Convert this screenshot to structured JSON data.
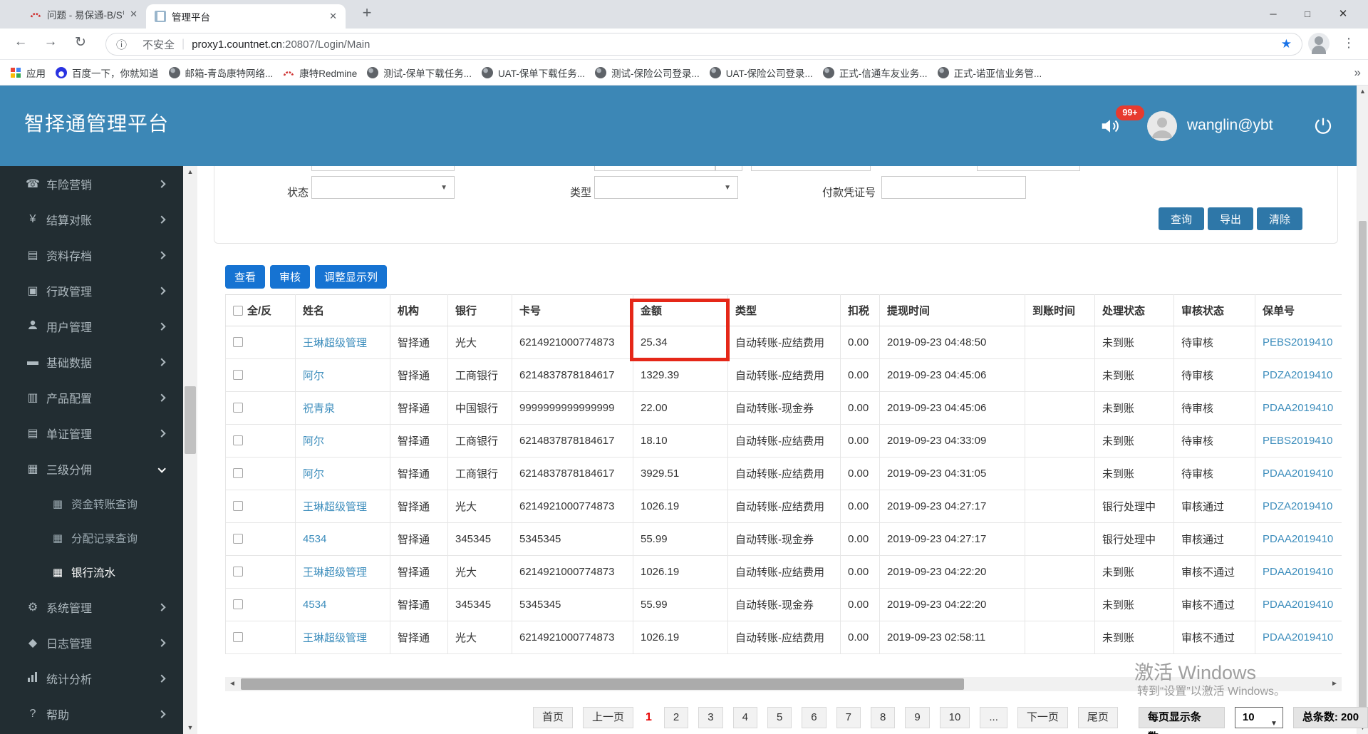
{
  "browser": {
    "tabs": [
      {
        "title": "问题 - 易保通-B/S管理系统 - Re...",
        "icon": "redmine-icon",
        "active": false
      },
      {
        "title": "管理平台",
        "icon": "tab-document-icon",
        "active": true
      }
    ],
    "tab_close": "✕",
    "new_tab_button": "+",
    "window_controls": {
      "minimize": "─",
      "maximize": "□",
      "close": "✕"
    },
    "nav": {
      "back": "←",
      "forward": "→",
      "reload": "↻"
    },
    "omnibox": {
      "info_icon": "ⓘ",
      "security_label": "不安全",
      "separator": "|",
      "host": "proxy1.countnet.cn",
      "path": ":20807/Login/Main"
    },
    "star_icon": "★",
    "menu_icon": "⋮",
    "bookmarks": [
      {
        "label": "应用",
        "icon": "apps-grid-icon"
      },
      {
        "label": "百度一下，你就知道",
        "icon": "baidu-icon"
      },
      {
        "label": "邮箱-青岛康特网络...",
        "icon": "globe-icon"
      },
      {
        "label": "康特Redmine",
        "icon": "redmine-icon"
      },
      {
        "label": "测试-保单下载任务...",
        "icon": "globe-icon"
      },
      {
        "label": "UAT-保单下载任务...",
        "icon": "globe-icon"
      },
      {
        "label": "测试-保险公司登录...",
        "icon": "globe-icon"
      },
      {
        "label": "UAT-保险公司登录...",
        "icon": "globe-icon"
      },
      {
        "label": "正式-信通车友业务...",
        "icon": "globe-icon"
      },
      {
        "label": "正式-诺亚信业务管...",
        "icon": "globe-icon"
      }
    ],
    "bookmarks_overflow": "»"
  },
  "header": {
    "title": "智择通管理平台",
    "notification_badge": "99+",
    "username": "wanglin@ybt"
  },
  "sidebar": {
    "items": [
      {
        "label": "车险营销",
        "icon": "phone-icon",
        "chevron": "right"
      },
      {
        "label": "结算对账",
        "icon": "yen-icon",
        "chevron": "right"
      },
      {
        "label": "资料存档",
        "icon": "archive-icon",
        "chevron": "right"
      },
      {
        "label": "行政管理",
        "icon": "briefcase-icon",
        "chevron": "right"
      },
      {
        "label": "用户管理",
        "icon": "user-icon",
        "chevron": "right"
      },
      {
        "label": "基础数据",
        "icon": "database-icon",
        "chevron": "right"
      },
      {
        "label": "产品配置",
        "icon": "book-icon",
        "chevron": "right"
      },
      {
        "label": "单证管理",
        "icon": "document-icon",
        "chevron": "right"
      },
      {
        "label": "三级分佣",
        "icon": "grid-icon",
        "chevron": "down",
        "expanded": true,
        "children": [
          {
            "label": "资金转账查询",
            "icon": "grid-icon",
            "active": false
          },
          {
            "label": "分配记录查询",
            "icon": "grid-icon",
            "active": false
          },
          {
            "label": "银行流水",
            "icon": "grid-icon",
            "active": true
          }
        ]
      },
      {
        "label": "系统管理",
        "icon": "gear-icon",
        "chevron": "right"
      },
      {
        "label": "日志管理",
        "icon": "tag-icon",
        "chevron": "right"
      },
      {
        "label": "统计分析",
        "icon": "chart-icon",
        "chevron": "right"
      },
      {
        "label": "帮助",
        "icon": "help-icon",
        "chevron": "right"
      }
    ]
  },
  "filters": {
    "status_label": "状态",
    "type_label": "类型",
    "voucher_label": "付款凭证号",
    "status_value": "",
    "type_value": "",
    "voucher_value": "",
    "buttons": [
      "查询",
      "导出",
      "清除"
    ]
  },
  "toolbar": {
    "buttons": [
      "查看",
      "审核",
      "调整显示列"
    ]
  },
  "table": {
    "headers": [
      "全/反",
      "姓名",
      "机构",
      "银行",
      "卡号",
      "金额",
      "类型",
      "扣税",
      "提现时间",
      "到账时间",
      "处理状态",
      "审核状态",
      "保单号"
    ],
    "highlighted_column": "金额",
    "rows": [
      [
        "王琳超级管理",
        "智择通",
        "光大",
        "6214921000774873",
        "25.34",
        "自动转账-应结费用",
        "0.00",
        "2019-09-23 04:48:50",
        "",
        "未到账",
        "待审核",
        "PEBS2019410"
      ],
      [
        "阿尔",
        "智择通",
        "工商银行",
        "6214837878184617",
        "1329.39",
        "自动转账-应结费用",
        "0.00",
        "2019-09-23 04:45:06",
        "",
        "未到账",
        "待审核",
        "PDZA2019410"
      ],
      [
        "祝青泉",
        "智择通",
        "中国银行",
        "9999999999999999",
        "22.00",
        "自动转账-现金券",
        "0.00",
        "2019-09-23 04:45:06",
        "",
        "未到账",
        "待审核",
        "PDAA2019410"
      ],
      [
        "阿尔",
        "智择通",
        "工商银行",
        "6214837878184617",
        "18.10",
        "自动转账-应结费用",
        "0.00",
        "2019-09-23 04:33:09",
        "",
        "未到账",
        "待审核",
        "PEBS2019410"
      ],
      [
        "阿尔",
        "智择通",
        "工商银行",
        "6214837878184617",
        "3929.51",
        "自动转账-应结费用",
        "0.00",
        "2019-09-23 04:31:05",
        "",
        "未到账",
        "待审核",
        "PDAA2019410"
      ],
      [
        "王琳超级管理",
        "智择通",
        "光大",
        "6214921000774873",
        "1026.19",
        "自动转账-应结费用",
        "0.00",
        "2019-09-23 04:27:17",
        "",
        "银行处理中",
        "审核通过",
        "PDZA2019410"
      ],
      [
        "4534",
        "智择通",
        "345345",
        "5345345",
        "55.99",
        "自动转账-现金券",
        "0.00",
        "2019-09-23 04:27:17",
        "",
        "银行处理中",
        "审核通过",
        "PDAA2019410"
      ],
      [
        "王琳超级管理",
        "智择通",
        "光大",
        "6214921000774873",
        "1026.19",
        "自动转账-应结费用",
        "0.00",
        "2019-09-23 04:22:20",
        "",
        "未到账",
        "审核不通过",
        "PDAA2019410"
      ],
      [
        "4534",
        "智择通",
        "345345",
        "5345345",
        "55.99",
        "自动转账-现金券",
        "0.00",
        "2019-09-23 04:22:20",
        "",
        "未到账",
        "审核不通过",
        "PDAA2019410"
      ],
      [
        "王琳超级管理",
        "智择通",
        "光大",
        "6214921000774873",
        "1026.19",
        "自动转账-应结费用",
        "0.00",
        "2019-09-23 02:58:11",
        "",
        "未到账",
        "审核不通过",
        "PDAA2019410"
      ]
    ]
  },
  "watermark": {
    "line1": "激活 Windows",
    "line2": "转到“设置”以激活 Windows。"
  },
  "pagination": {
    "first": "首页",
    "prev": "上一页",
    "pages": [
      "1",
      "2",
      "3",
      "4",
      "5",
      "6",
      "7",
      "8",
      "9",
      "10"
    ],
    "current": "1",
    "ellipsis": "...",
    "next": "下一页",
    "last": "尾页",
    "per_page_label": "每页显示条数:",
    "per_page_value": "10",
    "total_label": "总条数: 200"
  }
}
